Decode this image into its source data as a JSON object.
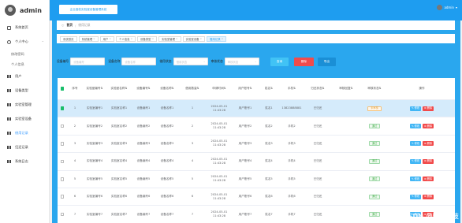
{
  "sidebar": {
    "brand": "admin",
    "items": [
      {
        "label": "系统首页",
        "icon": "home-icon"
      },
      {
        "label": "个人中心",
        "icon": "person-icon",
        "expanded": true,
        "children": [
          {
            "label": "修改密码"
          },
          {
            "label": "个人信息"
          }
        ]
      },
      {
        "label": "用户",
        "icon": "grid-icon"
      },
      {
        "label": "设备类型",
        "icon": "grid-icon"
      },
      {
        "label": "实验室管理",
        "icon": "grid-icon"
      },
      {
        "label": "实验室设备",
        "icon": "grid-icon"
      },
      {
        "label": "借用记录",
        "icon": "grid-icon",
        "active": true
      },
      {
        "label": "归还记录",
        "icon": "grid-icon"
      },
      {
        "label": "系统日志",
        "icon": "grid-icon"
      }
    ]
  },
  "topbar": {
    "system_title": "企业高校实验室设备管理系统",
    "user": "admin"
  },
  "breadcrumb": {
    "home": "首页",
    "current": "借用记录"
  },
  "tabs": [
    "系统首页",
    "系统管理",
    "用户",
    "个人信息",
    "设备类型",
    "实验室管理",
    "实验室设备",
    "借用记录"
  ],
  "search": {
    "field1_label": "设备编号",
    "field1_placeholder": "设备编号",
    "field2_label": "设备名称",
    "field2_placeholder": "设备名称",
    "field3_label": "借用状态",
    "field3_placeholder": "借用状态",
    "field4_label": "审核状态",
    "field4_placeholder": "审核状态",
    "query_button": "查询",
    "delete_button": "删除",
    "export_button": "导出"
  },
  "table": {
    "columns": [
      "序号",
      "实验室编号",
      "实验室名称",
      "设备编号",
      "设备名称",
      "借用数量",
      "申请时间",
      "用户账号",
      "姓名",
      "手机",
      "归还状态",
      "审核回复",
      "审核状态",
      "操作"
    ],
    "rows": [
      {
        "idx": "1",
        "c1": "实验室编号1",
        "c2": "实验室名称1",
        "c3": "设备编号1",
        "c4": "设备名称1",
        "c5": "1",
        "c6": "2024-05-01 11:43:28",
        "c7": "用户账号1",
        "c8": "姓名1",
        "c9": "13823888881",
        "c10": "已归还",
        "c11": "",
        "status": "未审核",
        "status_type": "warn",
        "selected": true
      },
      {
        "idx": "2",
        "c1": "实验室编号2",
        "c2": "实验室名称2",
        "c3": "设备编号2",
        "c4": "设备名称2",
        "c5": "2",
        "c6": "2024-05-01 11:43:28",
        "c7": "用户账号2",
        "c8": "姓名2",
        "c9": "手机2",
        "c10": "已归还",
        "c11": "",
        "status": "通过",
        "status_type": "ok",
        "selected": false
      },
      {
        "idx": "3",
        "c1": "实验室编号3",
        "c2": "实验室名称3",
        "c3": "设备编号3",
        "c4": "设备名称3",
        "c5": "3",
        "c6": "2024-05-01 11:43:28",
        "c7": "用户账号3",
        "c8": "姓名3",
        "c9": "手机3",
        "c10": "已归还",
        "c11": "",
        "status": "通过",
        "status_type": "ok",
        "selected": false
      },
      {
        "idx": "4",
        "c1": "实验室编号4",
        "c2": "实验室名称4",
        "c3": "设备编号4",
        "c4": "设备名称4",
        "c5": "4",
        "c6": "2024-05-01 11:43:28",
        "c7": "用户账号4",
        "c8": "姓名4",
        "c9": "手机4",
        "c10": "已归还",
        "c11": "",
        "status": "通过",
        "status_type": "ok",
        "selected": false
      },
      {
        "idx": "5",
        "c1": "实验室编号5",
        "c2": "实验室名称5",
        "c3": "设备编号5",
        "c4": "设备名称5",
        "c5": "5",
        "c6": "2024-05-01 11:43:28",
        "c7": "用户账号5",
        "c8": "姓名5",
        "c9": "手机5",
        "c10": "已归还",
        "c11": "",
        "status": "通过",
        "status_type": "ok",
        "selected": false
      },
      {
        "idx": "6",
        "c1": "实验室编号6",
        "c2": "实验室名称6",
        "c3": "设备编号6",
        "c4": "设备名称6",
        "c5": "6",
        "c6": "2024-05-01 11:43:28",
        "c7": "用户账号6",
        "c8": "姓名6",
        "c9": "手机6",
        "c10": "已归还",
        "c11": "",
        "status": "通过",
        "status_type": "ok",
        "selected": false
      },
      {
        "idx": "7",
        "c1": "实验室编号7",
        "c2": "实验室名称7",
        "c3": "设备编号7",
        "c4": "设备名称7",
        "c5": "7",
        "c6": "2024-05-01 11:43:28",
        "c7": "用户账号7",
        "c8": "姓名7",
        "c9": "手机7",
        "c10": "已归还",
        "c11": "",
        "status": "通过",
        "status_type": "ok",
        "selected": false
      }
    ],
    "action_edit": "修改",
    "action_delete": "删除"
  },
  "watermark": "CSDN @辉时科技",
  "colors": {
    "topbar": "#1e9df0",
    "panel": "#2aa7ee",
    "query": "#41c3f5",
    "delete": "#f14b4b",
    "export": "#1a8fd6",
    "selected_row": "#d5ebfb"
  }
}
